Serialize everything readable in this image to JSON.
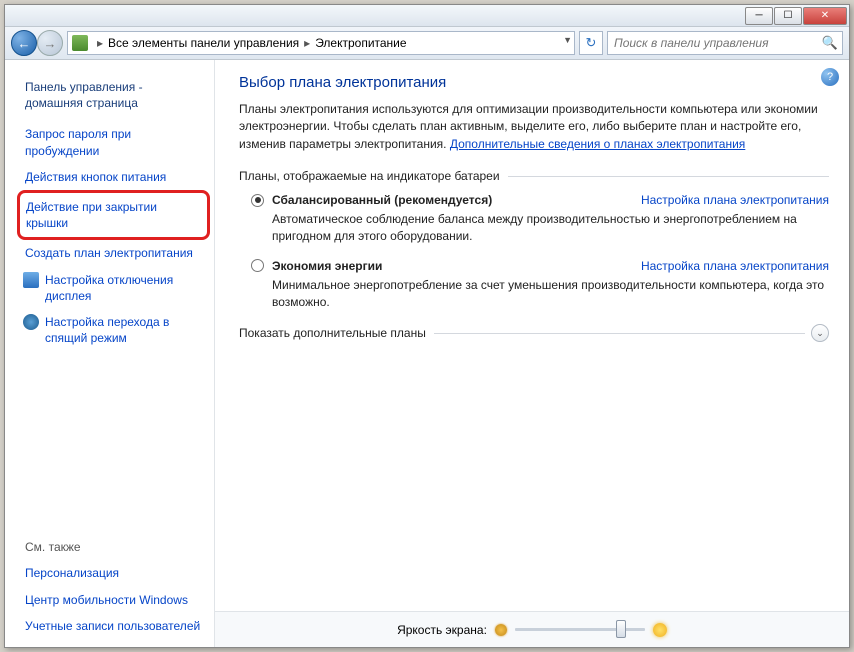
{
  "breadcrumb": {
    "item1": "Все элементы панели управления",
    "item2": "Электропитание"
  },
  "search": {
    "placeholder": "Поиск в панели управления"
  },
  "sidebar": {
    "home": "Панель управления - домашняя страница",
    "links": [
      "Запрос пароля при пробуждении",
      "Действия кнопок питания",
      "Действие при закрытии крышки",
      "Создать план электропитания",
      "Настройка отключения дисплея",
      "Настройка перехода в спящий режим"
    ],
    "seealso_hdr": "См. также",
    "seealso": [
      "Персонализация",
      "Центр мобильности Windows",
      "Учетные записи пользователей"
    ]
  },
  "main": {
    "title": "Выбор плана электропитания",
    "intro_pre": "Планы электропитания используются для оптимизации производительности компьютера или экономии электроэнергии. Чтобы сделать план активным, выделите его, либо выберите план и настройте его, изменив параметры электропитания. ",
    "intro_link": "Дополнительные сведения о планах электропитания",
    "group1": "Планы, отображаемые на индикаторе батареи",
    "plans": [
      {
        "name": "Сбалансированный (рекомендуется)",
        "cfg": "Настройка плана электропитания",
        "desc": "Автоматическое соблюдение баланса между производительностью и энергопотреблением на пригодном для этого оборудовании.",
        "selected": true
      },
      {
        "name": "Экономия энергии",
        "cfg": "Настройка плана электропитания",
        "desc": "Минимальное энергопотребление за счет уменьшения производительности компьютера, когда это возможно.",
        "selected": false
      }
    ],
    "group2": "Показать дополнительные планы",
    "brightness_label": "Яркость экрана:"
  }
}
